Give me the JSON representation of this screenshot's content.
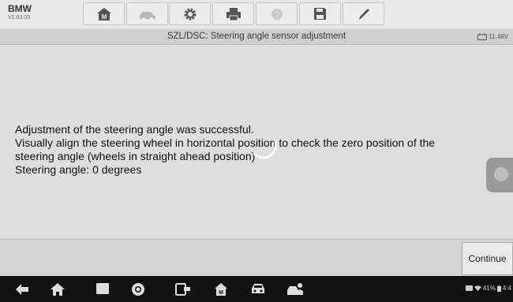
{
  "app": {
    "brand": "BMW",
    "version": "V1.03.03"
  },
  "toolbar": {
    "buttons": [
      {
        "name": "home-button",
        "icon": "home-icon",
        "enabled": true
      },
      {
        "name": "vehicle-swap-button",
        "icon": "vehicle-swap-icon",
        "enabled": false
      },
      {
        "name": "settings-button",
        "icon": "gear-icon",
        "enabled": true
      },
      {
        "name": "print-button",
        "icon": "print-icon",
        "enabled": true
      },
      {
        "name": "help-button",
        "icon": "help-icon",
        "enabled": false
      },
      {
        "name": "save-button",
        "icon": "floppy-disk-icon",
        "enabled": true
      },
      {
        "name": "edit-button",
        "icon": "pen-icon",
        "enabled": true
      }
    ]
  },
  "header": {
    "title": "SZL/DSC: Steering angle sensor adjustment",
    "battery_voltage": "11.48V"
  },
  "message": {
    "lines": [
      "Adjustment of the steering angle was successful.",
      "Visually align the steering wheel in horizontal position to check the zero position of the",
      "steering angle (wheels in straight ahead position)",
      "Steering angle: 0 degrees"
    ]
  },
  "actions": {
    "continue_label": "Continue"
  },
  "statusbar": {
    "battery_percent": "41%",
    "time": "4:4"
  },
  "colors": {
    "navbar": "#121212",
    "content_bg": "#dedede",
    "toolbar_bg": "#e8e8e8"
  }
}
